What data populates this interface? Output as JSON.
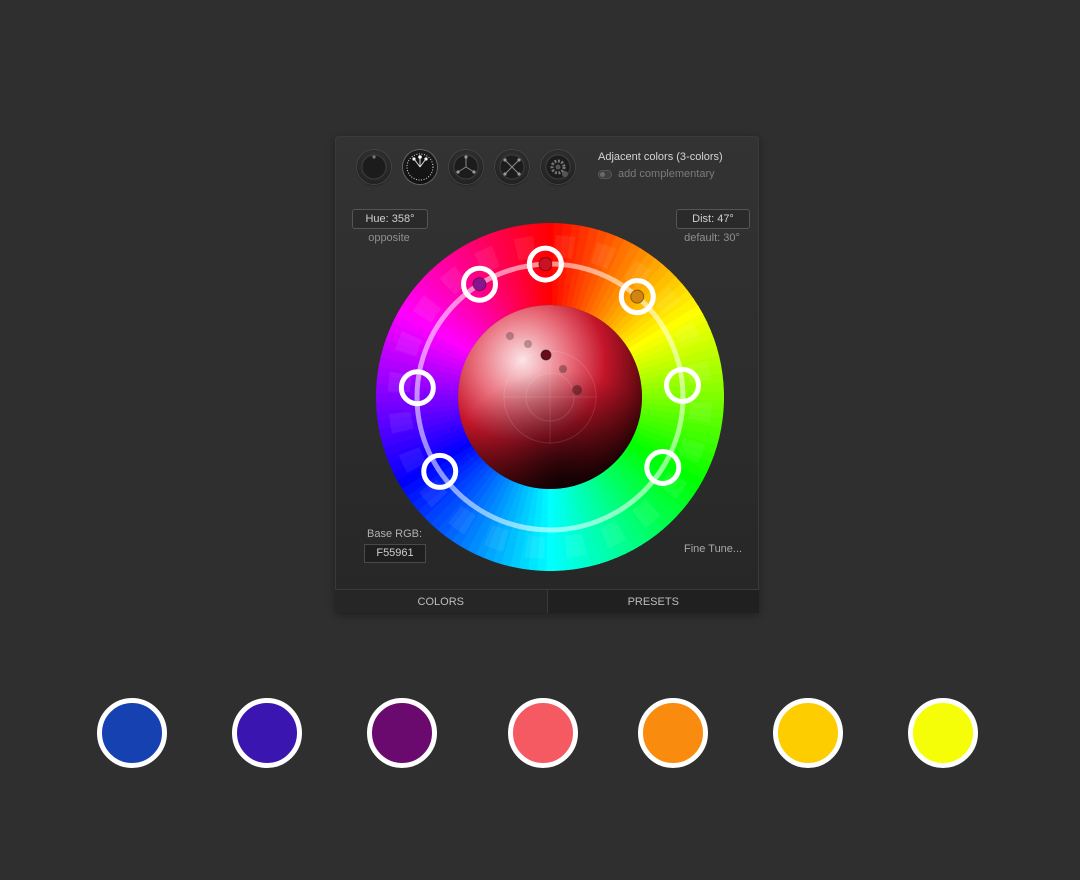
{
  "scheme": {
    "title": "Adjacent colors (3-colors)",
    "complement_label": "add complementary"
  },
  "mode_buttons": [
    {
      "icon": "mono-mode-icon"
    },
    {
      "icon": "adjacent-mode-icon",
      "active": true
    },
    {
      "icon": "triad-mode-icon"
    },
    {
      "icon": "tetrad-mode-icon"
    },
    {
      "icon": "settings-gear-icon"
    }
  ],
  "hue": {
    "value": "Hue: 358°",
    "sub": "opposite"
  },
  "dist": {
    "value": "Dist: 47°",
    "sub": "default: 30°"
  },
  "base_rgb": {
    "label": "Base RGB:",
    "value": "F55961"
  },
  "fine_tune": "Fine Tune...",
  "tabs": [
    {
      "label": "COLORS",
      "active": true
    },
    {
      "label": "PRESETS"
    }
  ],
  "handles": [
    {
      "hue": 358,
      "fill": "#cc1122"
    },
    {
      "hue": 328,
      "fill": "#8a1490"
    },
    {
      "hue": 41,
      "fill": "#d28410"
    },
    {
      "hue": 274,
      "fill": "none"
    },
    {
      "hue": 85,
      "fill": "none"
    },
    {
      "hue": 236,
      "fill": "none"
    },
    {
      "hue": 122,
      "fill": "none"
    }
  ],
  "swatches": [
    {
      "color": "#1641b0"
    },
    {
      "color": "#3a15b0"
    },
    {
      "color": "#6a0a6e"
    },
    {
      "color": "#f55961"
    },
    {
      "color": "#f98b0e"
    },
    {
      "color": "#fecd00"
    },
    {
      "color": "#f6fe07"
    }
  ]
}
